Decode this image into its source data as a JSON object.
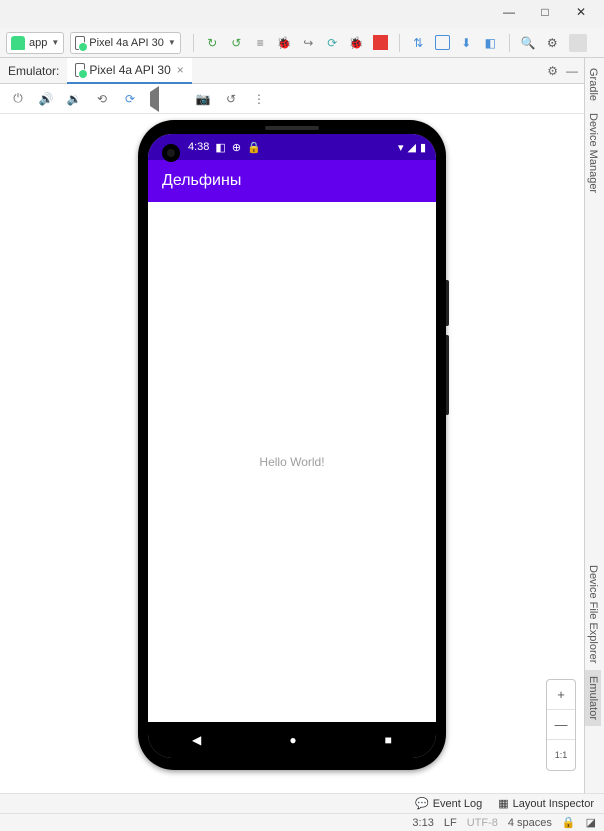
{
  "window": {
    "min": "—",
    "max": "□",
    "close": "✕"
  },
  "toolbar": {
    "app_combo": "app",
    "device_combo": "Pixel 4a API 30"
  },
  "tabrow": {
    "label": "Emulator:",
    "tab": "Pixel 4a API 30"
  },
  "phone": {
    "time": "4:38",
    "app_title": "Дельфины",
    "body_text": "Hello World!"
  },
  "zoom": {
    "plus": "+",
    "minus": "—",
    "fit": "1:1"
  },
  "right_tools": {
    "gradle": "Gradle",
    "devmgr": "Device Manager",
    "devfile": "Device File Explorer",
    "emu": "Emulator"
  },
  "bottom": {
    "eventlog": "Event Log",
    "layout": "Layout Inspector"
  },
  "status": {
    "pos": "3:13",
    "lf": "LF",
    "enc": "UTF-8",
    "indent": "4 spaces"
  }
}
